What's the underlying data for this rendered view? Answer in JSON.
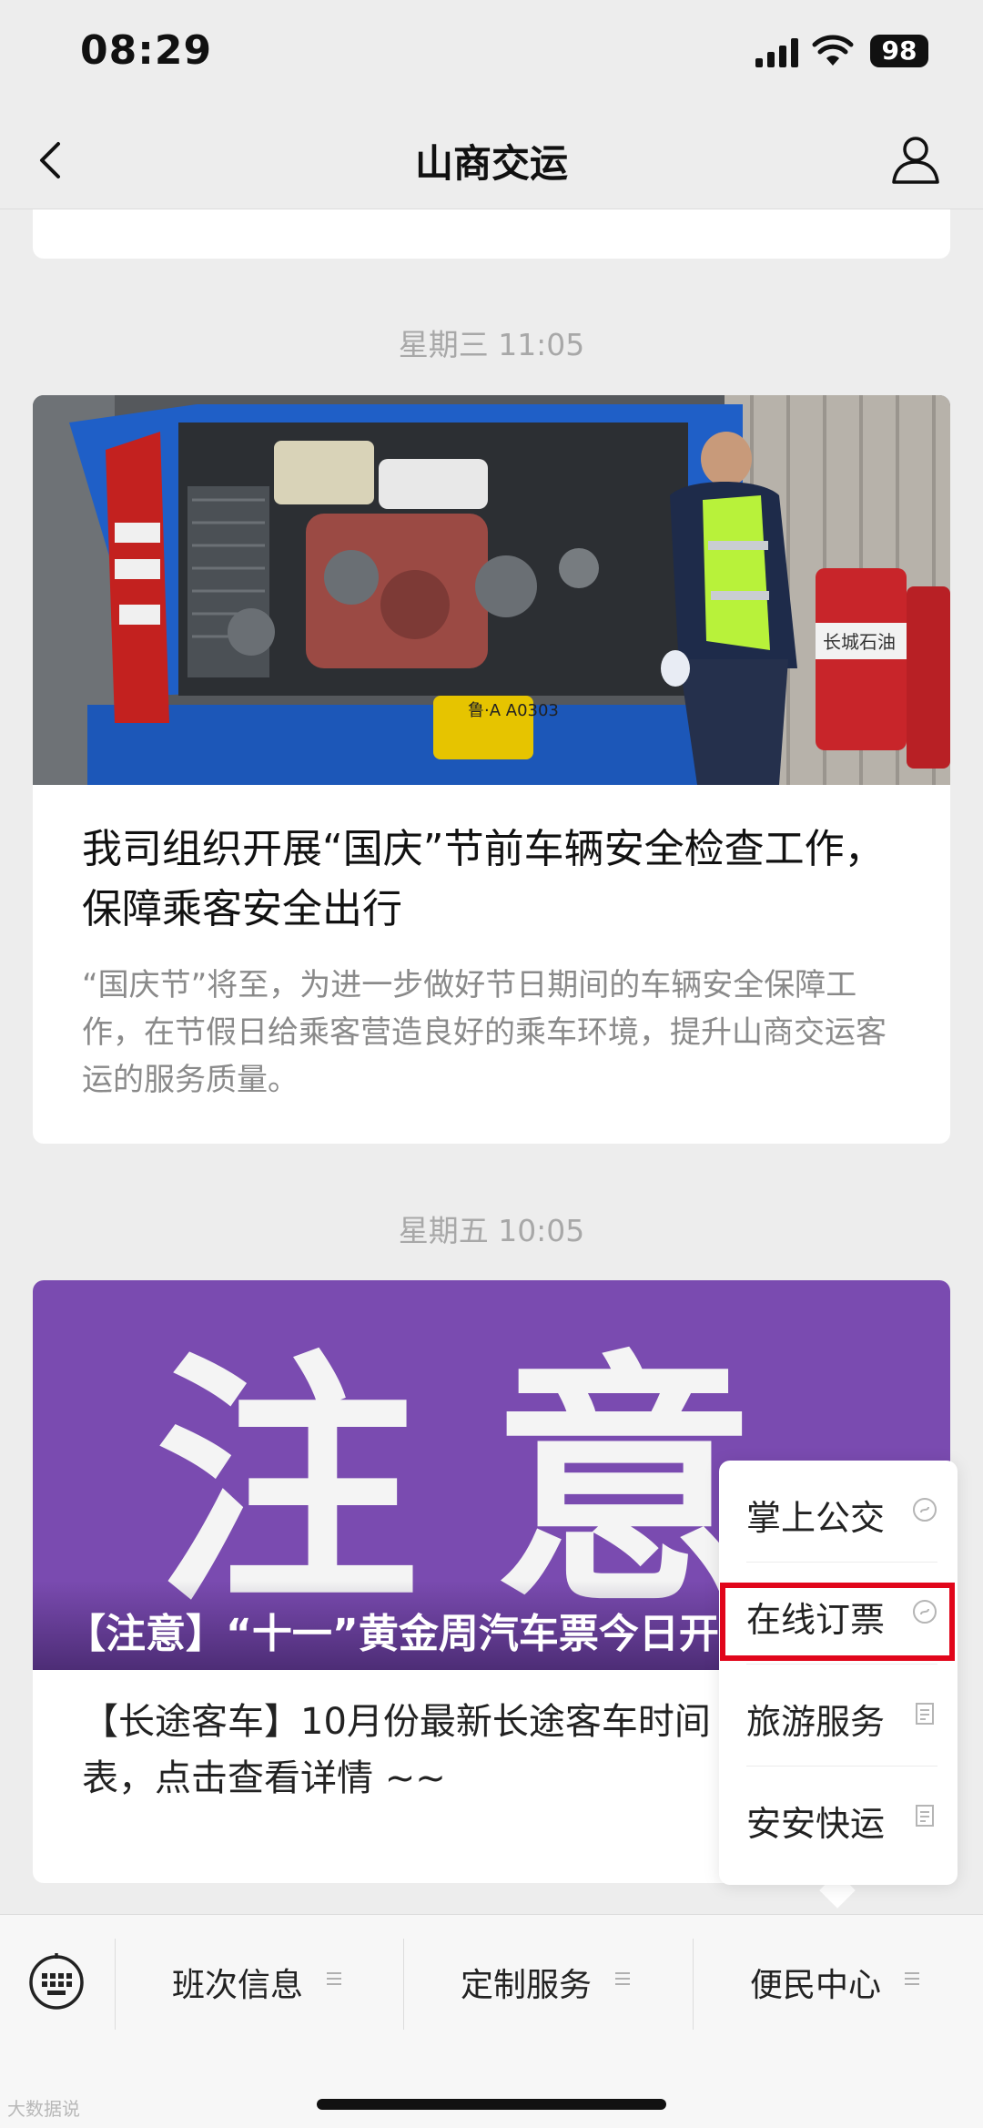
{
  "status_bar": {
    "time": "08:29",
    "battery": "98",
    "icons": [
      "signal-icon",
      "wifi-icon",
      "battery-icon"
    ]
  },
  "nav": {
    "title": "山商交运",
    "back_icon": "back-icon",
    "profile_icon": "profile-icon"
  },
  "messages": [
    {
      "timestamp": "星期三 11:05",
      "title": "我司组织开展“国庆”节前车辆安全检查工作，保障乘客安全出行",
      "description": "“国庆节”将至，为进一步做好节日期间的车辆安全保障工作，在节假日给乘客营造良好的乘车环境，提升山商交运客运的服务质量。",
      "plate_text": "鲁·A A0303",
      "drum_text": "长城石油"
    },
    {
      "timestamp": "星期五 10:05",
      "banner_text": "注意",
      "title": "【注意】“十一”黄金周汽车票今日开",
      "description": "【长途客车】10月份最新长途客车时间表，点击查看详情 ~~"
    }
  ],
  "popup_menu": {
    "items": [
      {
        "label": "掌上公交",
        "icon": "mini-program-icon"
      },
      {
        "label": "在线订票",
        "icon": "mini-program-icon",
        "highlighted": true
      },
      {
        "label": "旅游服务",
        "icon": "article-icon"
      },
      {
        "label": "安安快运",
        "icon": "article-icon"
      }
    ]
  },
  "tab_bar": {
    "keyboard_icon": "keyboard-icon",
    "tabs": [
      {
        "label": "班次信息",
        "icon": "menu-icon"
      },
      {
        "label": "定制服务",
        "icon": "menu-icon"
      },
      {
        "label": "便民中心",
        "icon": "menu-icon"
      }
    ]
  },
  "watermark": "大数据说",
  "colors": {
    "background": "#ededed",
    "banner_purple": "#7a4bb0",
    "highlight_red": "#e1061b",
    "timestamp_gray": "#a8a8a8"
  }
}
